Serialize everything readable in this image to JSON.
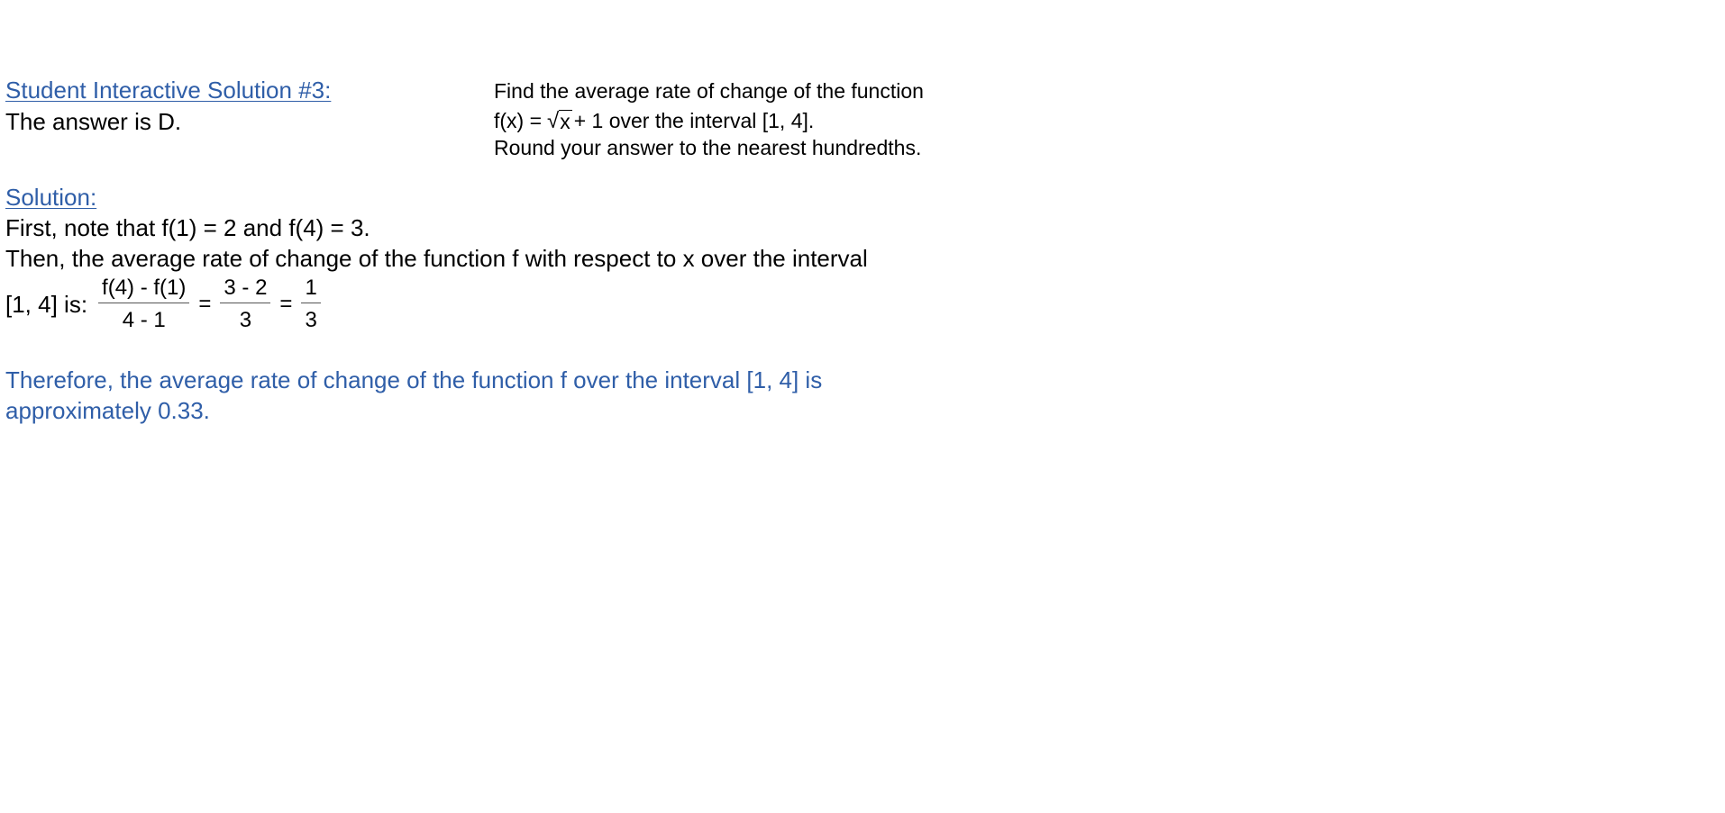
{
  "header": {
    "title": "Student Interactive Solution #3:",
    "answer": "The answer is D."
  },
  "problem": {
    "line1": "Find the average rate of change of the function",
    "line2_prefix": "f(x) = ",
    "line2_sqrt_sign": "√",
    "line2_radicand": "x",
    "line2_suffix": " + 1 over the interval [1, 4].",
    "line3": "Round your answer to the nearest hundredths."
  },
  "solution": {
    "heading": "Solution:",
    "step1": "First, note that f(1) = 2 and f(4) = 3.",
    "step2": "Then, the average rate of change of the function f with respect to x over the interval",
    "lead": "[1, 4] is:",
    "fraction1": {
      "numerator": "f(4) - f(1)",
      "denominator": "4 - 1"
    },
    "equals1": "=",
    "fraction2": {
      "numerator": "3 - 2",
      "denominator": "3"
    },
    "equals2": "=",
    "fraction3": {
      "numerator": "1",
      "denominator": "3"
    }
  },
  "conclusion": {
    "line1": "Therefore, the average rate of change of the function f over the interval [1, 4] is",
    "line2": "approximately 0.33."
  },
  "colors": {
    "accent_blue": "#2f5ea8",
    "text": "#000000",
    "background": "#ffffff"
  }
}
